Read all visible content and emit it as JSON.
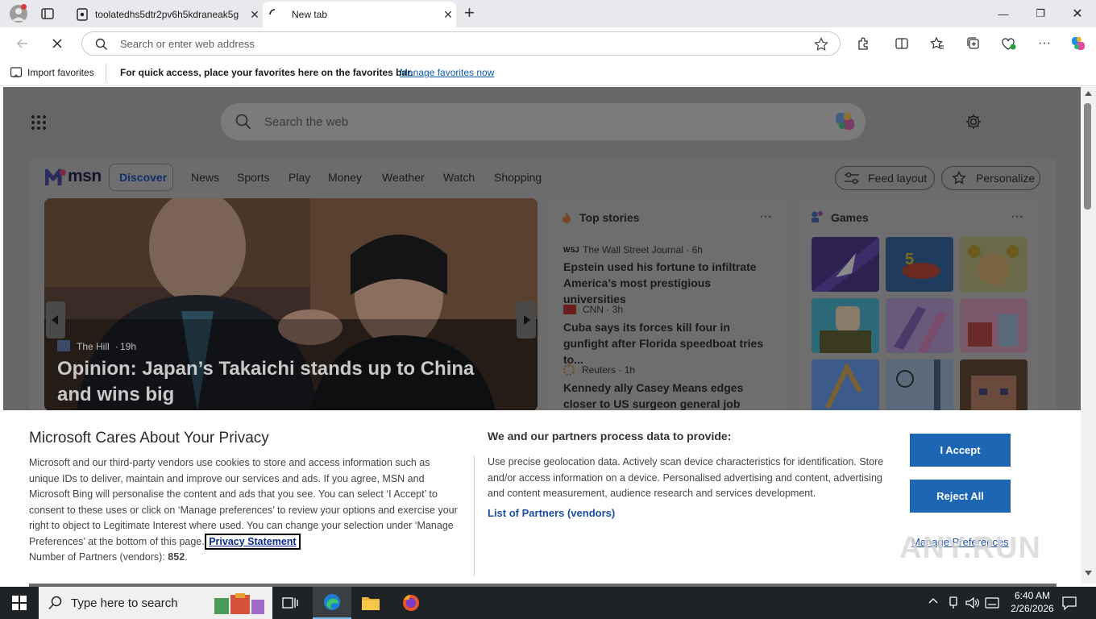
{
  "browser": {
    "tabs": [
      {
        "title": "toolatedhs5dtr2pv6h5kdraneak5g",
        "close": "✕"
      },
      {
        "title": "New tab",
        "close": "✕"
      }
    ],
    "new_tab": "+",
    "window": {
      "minimize": "—",
      "restore": "❐",
      "close": "✕"
    },
    "address_placeholder": "Search or enter web address",
    "favorites_bar": {
      "import_label": "Import favorites",
      "hint": "For quick access, place your favorites here on the favorites bar.",
      "manage_link": "Manage favorites now"
    }
  },
  "msn": {
    "search_placeholder": "Search the web",
    "logo_text": "msn",
    "nav": [
      "Discover",
      "News",
      "Sports",
      "Play",
      "Money",
      "Weather",
      "Watch",
      "Shopping"
    ],
    "feed_layout_label": "Feed layout",
    "personalize_label": "Personalize",
    "hero": {
      "source": "The Hill",
      "age": "19h",
      "title": "Opinion: Japan’s Takaichi stands up to China and wins big"
    },
    "top_stories": {
      "heading": "Top stories",
      "more": "···",
      "items": [
        {
          "source": "The Wall Street Journal",
          "age": "6h",
          "title": "Epstein used his fortune to infiltrate America’s most prestigious universities"
        },
        {
          "source": "CNN",
          "age": "3h",
          "title": "Cuba says its forces kill four in gunfight after Florida speedboat tries to..."
        },
        {
          "source": "Reuters",
          "age": "1h",
          "title": "Kennedy ally Casey Means edges closer to US surgeon general job"
        }
      ]
    },
    "games": {
      "heading": "Games",
      "more": "···"
    }
  },
  "consent": {
    "title": "Microsoft Cares About Your Privacy",
    "body": "Microsoft and our third-party vendors use cookies to store and access information such as unique IDs to deliver, maintain and improve our services and ads. If you agree, MSN and Microsoft Bing will personalise the content and ads that you see. You can select ‘I Accept’ to consent to these uses or click on ‘Manage preferences’ to review your options and exercise your right to object to Legitimate Interest where used.  You can change your selection under ‘Manage Preferences’ at the bottom of this page.",
    "privacy_link": "Privacy Statement",
    "partners_count_label": "Number of Partners (vendors):",
    "partners_count": "852",
    "right_heading": "We and our partners process data to provide:",
    "right_body": "Use precise geolocation data. Actively scan device characteristics for identification. Store and/or access information on a device. Personalised advertising and content, advertising and content measurement, audience research and services development.",
    "partners_link": "List of Partners (vendors)",
    "accept_label": "I Accept",
    "reject_label": "Reject All",
    "manage_label": "Manage Preferences"
  },
  "watermark": "ANY.RUN",
  "taskbar": {
    "search_placeholder": "Type here to search",
    "time": "6:40 AM",
    "date": "2/26/2026"
  }
}
